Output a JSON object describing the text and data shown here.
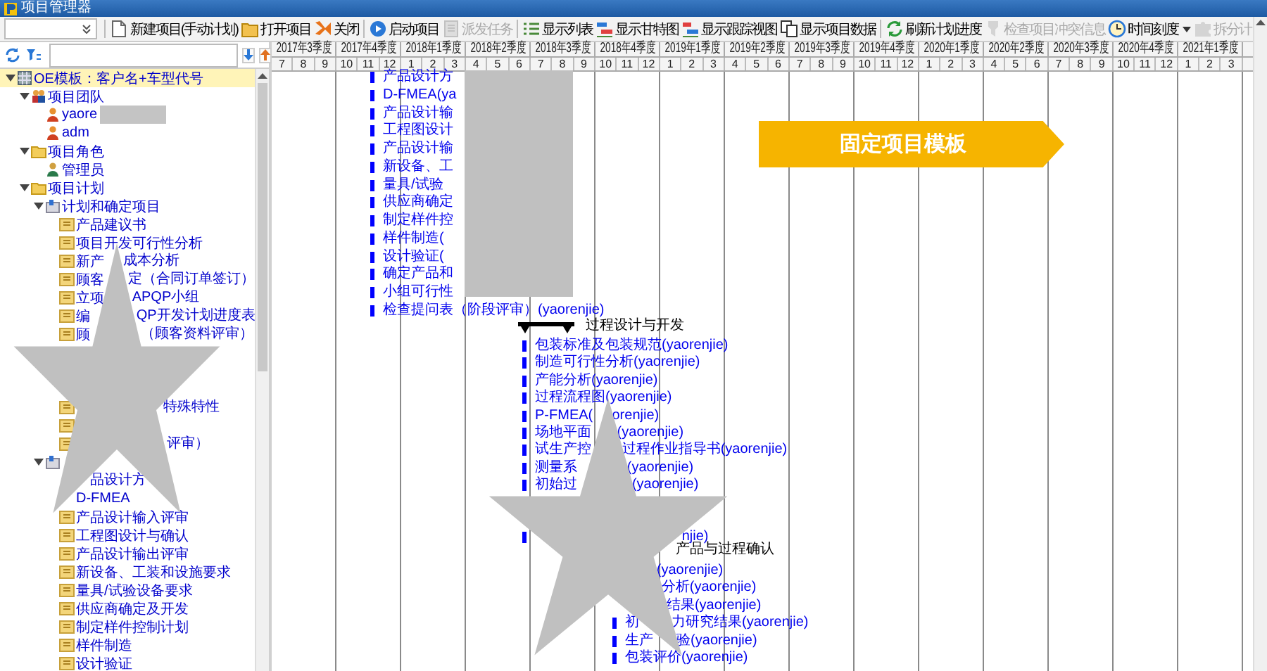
{
  "window": {
    "title": "项目管理器"
  },
  "toolbar": [
    [
      {
        "kind": "new",
        "label": "新建项目(手动计划)",
        "disabled": false,
        "dropdown": false
      },
      {
        "kind": "open",
        "label": "打开项目",
        "disabled": false,
        "dropdown": false
      },
      {
        "kind": "close",
        "label": "关闭",
        "disabled": false,
        "dropdown": false
      }
    ],
    [
      {
        "kind": "start",
        "label": "启动项目",
        "disabled": false,
        "dropdown": false
      },
      {
        "kind": "dispatch",
        "label": "派发任务",
        "disabled": true,
        "dropdown": false
      }
    ],
    [
      {
        "kind": "list",
        "label": "显示列表",
        "disabled": false,
        "dropdown": false
      },
      {
        "kind": "gantt",
        "label": "显示甘特图",
        "disabled": false,
        "dropdown": false
      },
      {
        "kind": "tracking",
        "label": "显示跟踪视图",
        "disabled": false,
        "dropdown": false
      },
      {
        "kind": "data",
        "label": "显示项目数据",
        "disabled": false,
        "dropdown": false
      }
    ],
    [
      {
        "kind": "refresh",
        "label": "刷新计划进度",
        "disabled": false,
        "dropdown": false
      },
      {
        "kind": "check",
        "label": "检查项目冲突信息",
        "disabled": true,
        "dropdown": false
      },
      {
        "kind": "clock",
        "label": "时间刻度",
        "disabled": false,
        "dropdown": true
      },
      {
        "kind": "split",
        "label": "拆分计",
        "disabled": true,
        "dropdown": false
      }
    ]
  ],
  "tree": [
    {
      "kind": "template",
      "text": "OE模板：客户名+车型代号",
      "selected": true,
      "expanded": true,
      "children": [
        {
          "kind": "team",
          "text": "项目团队",
          "selected": false,
          "expanded": true,
          "children": [
            {
              "kind": "user",
              "text": "yaore",
              "redacted": true,
              "selected": false
            },
            {
              "kind": "user",
              "text": "adm",
              "redacted": false,
              "selected": false
            }
          ]
        },
        {
          "kind": "folder",
          "text": "项目角色",
          "selected": false,
          "expanded": true,
          "children": [
            {
              "kind": "role",
              "text": "管理员",
              "selected": false
            }
          ]
        },
        {
          "kind": "folder",
          "text": "项目计划",
          "selected": false,
          "expanded": true,
          "children": [
            {
              "kind": "phase",
              "text": "计划和确定项目",
              "selected": false,
              "expanded": true,
              "children": [
                {
                  "kind": "task",
                  "text": "产品建议书",
                  "selected": false
                },
                {
                  "kind": "task",
                  "text": "项目开发可行性分析",
                  "selected": false
                },
                {
                  "kind": "task",
                  "left": "新产",
                  "right": "成本分析",
                  "selected": false
                },
                {
                  "kind": "task",
                  "left": "顾客",
                  "right": "定（合同订单签订）",
                  "selected": false
                },
                {
                  "kind": "task",
                  "left": "立项",
                  "right": "APQP小组",
                  "selected": false
                },
                {
                  "kind": "task",
                  "left": "编",
                  "right": "QP开发计划进度表",
                  "selected": false
                },
                {
                  "kind": "task",
                  "left": "顾",
                  "right": "（顾客资料评审）",
                  "selected": false
                },
                {
                  "kind": "task",
                  "right": "特殊特性",
                  "selected": false
                },
                {
                  "kind": "task",
                  "selected": false
                },
                {
                  "kind": "task",
                  "right": "评审）",
                  "selected": false
                }
              ]
            },
            {
              "kind": "phase",
              "selected": false,
              "expanded": true,
              "children": [
                {
                  "kind": "task",
                  "right": "品设计方",
                  "selected": false
                },
                {
                  "kind": "task",
                  "text": "D-FMEA",
                  "selected": false
                },
                {
                  "kind": "task",
                  "text": "产品设计输入评审",
                  "selected": false
                },
                {
                  "kind": "task",
                  "text": "工程图设计与确认",
                  "selected": false
                },
                {
                  "kind": "task",
                  "text": "产品设计输出评审",
                  "selected": false
                },
                {
                  "kind": "task",
                  "text": "新设备、工装和设施要求",
                  "selected": false
                },
                {
                  "kind": "task",
                  "text": "量具/试验设备要求",
                  "selected": false
                },
                {
                  "kind": "task",
                  "text": "供应商确定及开发",
                  "selected": false
                },
                {
                  "kind": "task",
                  "text": "制定样件控制计划",
                  "selected": false
                },
                {
                  "kind": "task",
                  "text": "样件制造",
                  "selected": false
                },
                {
                  "kind": "task",
                  "text": "设计验证",
                  "selected": false
                }
              ]
            }
          ]
        }
      ]
    }
  ],
  "timeline": [
    {
      "label": "2017年3季度",
      "months": [
        "7",
        "8",
        "9"
      ]
    },
    {
      "label": "2017年4季度",
      "months": [
        "10",
        "11",
        "12"
      ]
    },
    {
      "label": "2018年1季度",
      "months": [
        "1",
        "2",
        "3"
      ]
    },
    {
      "label": "2018年2季度",
      "months": [
        "4",
        "5",
        "6"
      ]
    },
    {
      "label": "2018年3季度",
      "months": [
        "7",
        "8",
        "9"
      ]
    },
    {
      "label": "2018年4季度",
      "months": [
        "10",
        "11",
        "12"
      ]
    },
    {
      "label": "2019年1季度",
      "months": [
        "1",
        "2",
        "3"
      ]
    },
    {
      "label": "2019年2季度",
      "months": [
        "4",
        "5",
        "6"
      ]
    },
    {
      "label": "2019年3季度",
      "months": [
        "7",
        "8",
        "9"
      ]
    },
    {
      "label": "2019年4季度",
      "months": [
        "10",
        "11",
        "12"
      ]
    },
    {
      "label": "2020年1季度",
      "months": [
        "1",
        "2",
        "3"
      ]
    },
    {
      "label": "2020年2季度",
      "months": [
        "4",
        "5",
        "6"
      ]
    },
    {
      "label": "2020年3季度",
      "months": [
        "7",
        "8",
        "9"
      ]
    },
    {
      "label": "2020年4季度",
      "months": [
        "10",
        "11",
        "12"
      ]
    },
    {
      "label": "2021年1季度",
      "months": [
        "1",
        "2",
        "3"
      ]
    }
  ],
  "gantt": [
    {
      "tasks": [
        {
          "text": "产品设计方"
        },
        {
          "text": "D-FMEA(ya"
        },
        {
          "text": "产品设计输"
        },
        {
          "text": "工程图设计"
        },
        {
          "text": "产品设计输"
        },
        {
          "text": "新设备、工"
        },
        {
          "text": "量具/试验"
        },
        {
          "text": "供应商确定"
        },
        {
          "text": "制定样件控"
        },
        {
          "text": "样件制造("
        },
        {
          "text": "设计验证("
        },
        {
          "text": "确定产品和"
        },
        {
          "text": "小组可行性"
        },
        {
          "text": "检查提问表（阶段评审）(yaorenjie)"
        }
      ]
    },
    {
      "title": "过程设计与开发",
      "tasks": [
        {
          "text": "包装标准及包装规范(yaorenjie)"
        },
        {
          "text": "制造可行性分析(yaorenjie)"
        },
        {
          "text": "产能分析(yaorenjie)"
        },
        {
          "text": "过程流程图(yaorenjie)"
        },
        {
          "left": "P-FMEA(",
          "right": "orenjie)"
        },
        {
          "left": "场地平面",
          "right": "(yaorenjie)"
        },
        {
          "left": "试生产控",
          "right": "过程作业指导书(yaorenjie)"
        },
        {
          "left": "测量系",
          "right": "(yaorenjie)"
        },
        {
          "left": "初始过",
          "right": "(yaorenjie)"
        },
        {
          "right": "njie)"
        }
      ]
    },
    {
      "title": "产品与过程确认",
      "tasks": [
        {
          "right": "(yaorenjie)"
        },
        {
          "right": "分析(yaorenjie)"
        },
        {
          "right": "结果(yaorenjie)"
        },
        {
          "left": "初",
          "right": "力研究结果(yaorenjie)"
        },
        {
          "left": "生产",
          "right": "验(yaorenjie)"
        },
        {
          "text": "包装评价(yaorenjie)"
        }
      ]
    }
  ],
  "banner": {
    "text": "固定项目模板"
  },
  "redactions": [
    {
      "kind": "star"
    },
    {
      "kind": "star"
    },
    {
      "kind": "block"
    }
  ]
}
